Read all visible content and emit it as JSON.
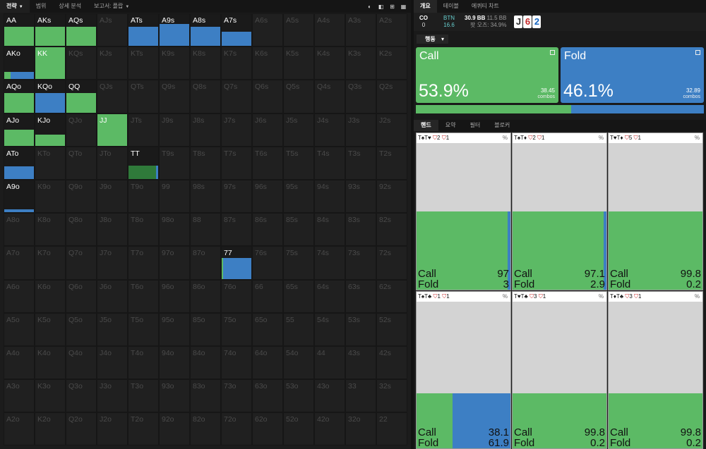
{
  "topnav": {
    "tabs": [
      {
        "label": "전략",
        "caret": true,
        "active": true
      },
      {
        "label": "범위",
        "caret": false,
        "active": false
      },
      {
        "label": "상세 분석",
        "caret": false,
        "active": false
      },
      {
        "label": "보고서: 플랍",
        "caret": true,
        "active": false
      }
    ]
  },
  "grid": {
    "rows": [
      [
        {
          "l": "AA",
          "a": 1,
          "c": 1,
          "f": 0,
          "h": 0.6
        },
        {
          "l": "AKs",
          "a": 1,
          "c": 1,
          "f": 0,
          "h": 0.6
        },
        {
          "l": "AQs",
          "a": 1,
          "c": 1,
          "f": 0,
          "h": 0.6
        },
        {
          "l": "AJs",
          "a": 0
        },
        {
          "l": "ATs",
          "a": 1,
          "c": 0,
          "f": 1,
          "h": 0.6
        },
        {
          "l": "A9s",
          "a": 1,
          "c": 0,
          "f": 1,
          "h": 0.68
        },
        {
          "l": "A8s",
          "a": 1,
          "c": 0,
          "f": 1,
          "h": 0.6
        },
        {
          "l": "A7s",
          "a": 1,
          "c": 0,
          "f": 1,
          "h": 0.45
        },
        {
          "l": "A6s",
          "a": 0
        },
        {
          "l": "A5s",
          "a": 0
        },
        {
          "l": "A4s",
          "a": 0
        },
        {
          "l": "A3s",
          "a": 0
        },
        {
          "l": "A2s",
          "a": 0
        }
      ],
      [
        {
          "l": "AKo",
          "a": 1,
          "c": 0.22,
          "f": 0.78,
          "h": 0.22
        },
        {
          "l": "KK",
          "a": 1,
          "c": 1,
          "f": 0,
          "h": 1
        },
        {
          "l": "KQs",
          "a": 0
        },
        {
          "l": "KJs",
          "a": 0
        },
        {
          "l": "KTs",
          "a": 0
        },
        {
          "l": "K9s",
          "a": 0
        },
        {
          "l": "K8s",
          "a": 0
        },
        {
          "l": "K7s",
          "a": 0
        },
        {
          "l": "K6s",
          "a": 0
        },
        {
          "l": "K5s",
          "a": 0
        },
        {
          "l": "K4s",
          "a": 0
        },
        {
          "l": "K3s",
          "a": 0
        },
        {
          "l": "K2s",
          "a": 0
        }
      ],
      [
        {
          "l": "AQo",
          "a": 1,
          "c": 1,
          "f": 0,
          "h": 0.6
        },
        {
          "l": "KQo",
          "a": 1,
          "c": 0,
          "f": 1,
          "h": 0.6
        },
        {
          "l": "QQ",
          "a": 1,
          "c": 1,
          "f": 0,
          "h": 0.6
        },
        {
          "l": "QJs",
          "a": 0
        },
        {
          "l": "QTs",
          "a": 0
        },
        {
          "l": "Q9s",
          "a": 0
        },
        {
          "l": "Q8s",
          "a": 0
        },
        {
          "l": "Q7s",
          "a": 0
        },
        {
          "l": "Q6s",
          "a": 0
        },
        {
          "l": "Q5s",
          "a": 0
        },
        {
          "l": "Q4s",
          "a": 0
        },
        {
          "l": "Q3s",
          "a": 0
        },
        {
          "l": "Q2s",
          "a": 0
        }
      ],
      [
        {
          "l": "AJo",
          "a": 1,
          "c": 1,
          "f": 0,
          "h": 0.5
        },
        {
          "l": "KJo",
          "a": 1,
          "c": 1,
          "f": 0,
          "h": 0.35
        },
        {
          "l": "QJo",
          "a": 0
        },
        {
          "l": "JJ",
          "a": 1,
          "c": 1,
          "f": 0,
          "h": 1
        },
        {
          "l": "JTs",
          "a": 0
        },
        {
          "l": "J9s",
          "a": 0
        },
        {
          "l": "J8s",
          "a": 0
        },
        {
          "l": "J7s",
          "a": 0
        },
        {
          "l": "J6s",
          "a": 0
        },
        {
          "l": "J5s",
          "a": 0
        },
        {
          "l": "J4s",
          "a": 0
        },
        {
          "l": "J3s",
          "a": 0
        },
        {
          "l": "J2s",
          "a": 0
        }
      ],
      [
        {
          "l": "ATo",
          "a": 1,
          "c": 0,
          "f": 1,
          "h": 0.4
        },
        {
          "l": "KTo",
          "a": 0
        },
        {
          "l": "QTo",
          "a": 0
        },
        {
          "l": "JTo",
          "a": 0
        },
        {
          "l": "TT",
          "a": 1,
          "c": 0.93,
          "f": 0.07,
          "h": 0.42
        },
        {
          "l": "T9s",
          "a": 0
        },
        {
          "l": "T8s",
          "a": 0
        },
        {
          "l": "T7s",
          "a": 0
        },
        {
          "l": "T6s",
          "a": 0
        },
        {
          "l": "T5s",
          "a": 0
        },
        {
          "l": "T4s",
          "a": 0
        },
        {
          "l": "T3s",
          "a": 0
        },
        {
          "l": "T2s",
          "a": 0
        }
      ],
      [
        {
          "l": "A9o",
          "a": 1,
          "c": 0,
          "f": 1,
          "h": 0.1
        },
        {
          "l": "K9o",
          "a": 0
        },
        {
          "l": "Q9o",
          "a": 0
        },
        {
          "l": "J9o",
          "a": 0
        },
        {
          "l": "T9o",
          "a": 0
        },
        {
          "l": "99",
          "a": 0
        },
        {
          "l": "98s",
          "a": 0
        },
        {
          "l": "97s",
          "a": 0
        },
        {
          "l": "96s",
          "a": 0
        },
        {
          "l": "95s",
          "a": 0
        },
        {
          "l": "94s",
          "a": 0
        },
        {
          "l": "93s",
          "a": 0
        },
        {
          "l": "92s",
          "a": 0
        }
      ],
      [
        {
          "l": "A8o",
          "a": 0
        },
        {
          "l": "K8o",
          "a": 0
        },
        {
          "l": "Q8o",
          "a": 0
        },
        {
          "l": "J8o",
          "a": 0
        },
        {
          "l": "T8o",
          "a": 0
        },
        {
          "l": "98o",
          "a": 0
        },
        {
          "l": "88",
          "a": 0
        },
        {
          "l": "87s",
          "a": 0
        },
        {
          "l": "86s",
          "a": 0
        },
        {
          "l": "85s",
          "a": 0
        },
        {
          "l": "84s",
          "a": 0
        },
        {
          "l": "83s",
          "a": 0
        },
        {
          "l": "82s",
          "a": 0
        }
      ],
      [
        {
          "l": "A7o",
          "a": 0
        },
        {
          "l": "K7o",
          "a": 0
        },
        {
          "l": "Q7o",
          "a": 0
        },
        {
          "l": "J7o",
          "a": 0
        },
        {
          "l": "T7o",
          "a": 0
        },
        {
          "l": "97o",
          "a": 0
        },
        {
          "l": "87o",
          "a": 0
        },
        {
          "l": "77",
          "a": 1,
          "c": 0.05,
          "f": 0.95,
          "h": 0.65
        },
        {
          "l": "76s",
          "a": 0
        },
        {
          "l": "75s",
          "a": 0
        },
        {
          "l": "74s",
          "a": 0
        },
        {
          "l": "73s",
          "a": 0
        },
        {
          "l": "72s",
          "a": 0
        }
      ],
      [
        {
          "l": "A6o",
          "a": 0
        },
        {
          "l": "K6o",
          "a": 0
        },
        {
          "l": "Q6o",
          "a": 0
        },
        {
          "l": "J6o",
          "a": 0
        },
        {
          "l": "T6o",
          "a": 0
        },
        {
          "l": "96o",
          "a": 0
        },
        {
          "l": "86o",
          "a": 0
        },
        {
          "l": "76o",
          "a": 0
        },
        {
          "l": "66",
          "a": 0
        },
        {
          "l": "65s",
          "a": 0
        },
        {
          "l": "64s",
          "a": 0
        },
        {
          "l": "63s",
          "a": 0
        },
        {
          "l": "62s",
          "a": 0
        }
      ],
      [
        {
          "l": "A5o",
          "a": 0
        },
        {
          "l": "K5o",
          "a": 0
        },
        {
          "l": "Q5o",
          "a": 0
        },
        {
          "l": "J5o",
          "a": 0
        },
        {
          "l": "T5o",
          "a": 0
        },
        {
          "l": "95o",
          "a": 0
        },
        {
          "l": "85o",
          "a": 0
        },
        {
          "l": "75o",
          "a": 0
        },
        {
          "l": "65o",
          "a": 0
        },
        {
          "l": "55",
          "a": 0
        },
        {
          "l": "54s",
          "a": 0
        },
        {
          "l": "53s",
          "a": 0
        },
        {
          "l": "52s",
          "a": 0
        }
      ],
      [
        {
          "l": "A4o",
          "a": 0
        },
        {
          "l": "K4o",
          "a": 0
        },
        {
          "l": "Q4o",
          "a": 0
        },
        {
          "l": "J4o",
          "a": 0
        },
        {
          "l": "T4o",
          "a": 0
        },
        {
          "l": "94o",
          "a": 0
        },
        {
          "l": "84o",
          "a": 0
        },
        {
          "l": "74o",
          "a": 0
        },
        {
          "l": "64o",
          "a": 0
        },
        {
          "l": "54o",
          "a": 0
        },
        {
          "l": "44",
          "a": 0
        },
        {
          "l": "43s",
          "a": 0
        },
        {
          "l": "42s",
          "a": 0
        }
      ],
      [
        {
          "l": "A3o",
          "a": 0
        },
        {
          "l": "K3o",
          "a": 0
        },
        {
          "l": "Q3o",
          "a": 0
        },
        {
          "l": "J3o",
          "a": 0
        },
        {
          "l": "T3o",
          "a": 0
        },
        {
          "l": "93o",
          "a": 0
        },
        {
          "l": "83o",
          "a": 0
        },
        {
          "l": "73o",
          "a": 0
        },
        {
          "l": "63o",
          "a": 0
        },
        {
          "l": "53o",
          "a": 0
        },
        {
          "l": "43o",
          "a": 0
        },
        {
          "l": "33",
          "a": 0
        },
        {
          "l": "32s",
          "a": 0
        }
      ],
      [
        {
          "l": "A2o",
          "a": 0
        },
        {
          "l": "K2o",
          "a": 0
        },
        {
          "l": "Q2o",
          "a": 0
        },
        {
          "l": "J2o",
          "a": 0
        },
        {
          "l": "T2o",
          "a": 0
        },
        {
          "l": "92o",
          "a": 0
        },
        {
          "l": "82o",
          "a": 0
        },
        {
          "l": "72o",
          "a": 0
        },
        {
          "l": "62o",
          "a": 0
        },
        {
          "l": "52o",
          "a": 0
        },
        {
          "l": "42o",
          "a": 0
        },
        {
          "l": "32o",
          "a": 0
        },
        {
          "l": "22",
          "a": 0
        }
      ]
    ]
  },
  "right_tabs": [
    {
      "label": "개요",
      "active": true
    },
    {
      "label": "테이블",
      "active": false
    },
    {
      "label": "에퀴티 차트",
      "active": false
    }
  ],
  "info": {
    "position": "CO",
    "position_value": "0",
    "button_label": "BTN",
    "button_value": "16.6",
    "pot": "30.9 BB",
    "stack": "11.5 BB",
    "pot_odds_label": "팟 오즈:",
    "pot_odds": "34.9%",
    "board": [
      {
        "rank": "J",
        "color": "#2b2b2b"
      },
      {
        "rank": "6",
        "color": "#c62828"
      },
      {
        "rank": "2",
        "color": "#1565c0"
      }
    ]
  },
  "action_header": "행동",
  "actions": [
    {
      "name": "Call",
      "pct": "53.9%",
      "combos": "38.45",
      "combos_label": "combos",
      "color": "#5cba65",
      "freq": 0.539
    },
    {
      "name": "Fold",
      "pct": "46.1%",
      "combos": "32.89",
      "combos_label": "combos",
      "color": "#3d7fc4",
      "freq": 0.461
    }
  ],
  "hand_tabs": [
    {
      "label": "핸드",
      "active": true
    },
    {
      "label": "요약",
      "active": false
    },
    {
      "label": "필터",
      "active": false
    },
    {
      "label": "블로커",
      "active": false
    }
  ],
  "combos": [
    {
      "hand": "T♠T♥",
      "n1": "2",
      "n2": "1",
      "call": "97",
      "fold": "3",
      "call_frac": 0.97,
      "height": 0.5,
      "suits": [
        "blk",
        "red"
      ]
    },
    {
      "hand": "T♠T♦",
      "n1": "2",
      "n2": "1",
      "call": "97.1",
      "fold": "2.9",
      "call_frac": 0.971,
      "height": 0.5,
      "suits": [
        "blk",
        "red"
      ]
    },
    {
      "hand": "T♥T♦",
      "n1": "5",
      "n2": "1",
      "call": "99.8",
      "fold": "0.2",
      "call_frac": 0.998,
      "height": 0.5,
      "suits": [
        "red",
        "red"
      ]
    },
    {
      "hand": "T♠T♣",
      "n1": "1",
      "n2": "1",
      "call": "38.1",
      "fold": "61.9",
      "call_frac": 0.381,
      "height": 0.35,
      "suits": [
        "blk",
        "blk"
      ]
    },
    {
      "hand": "T♥T♣",
      "n1": "3",
      "n2": "1",
      "call": "99.8",
      "fold": "0.2",
      "call_frac": 0.998,
      "height": 0.35,
      "suits": [
        "red",
        "blk"
      ]
    },
    {
      "hand": "T♦T♣",
      "n1": "3",
      "n2": "1",
      "call": "99.8",
      "fold": "0.2",
      "call_frac": 0.998,
      "height": 0.35,
      "suits": [
        "red",
        "blk"
      ]
    }
  ],
  "labels": {
    "call": "Call",
    "fold": "Fold",
    "percent": "%"
  },
  "colors": {
    "call": "#5cba65",
    "fold": "#3d7fc4",
    "tt_call": "#2f7a3a"
  }
}
